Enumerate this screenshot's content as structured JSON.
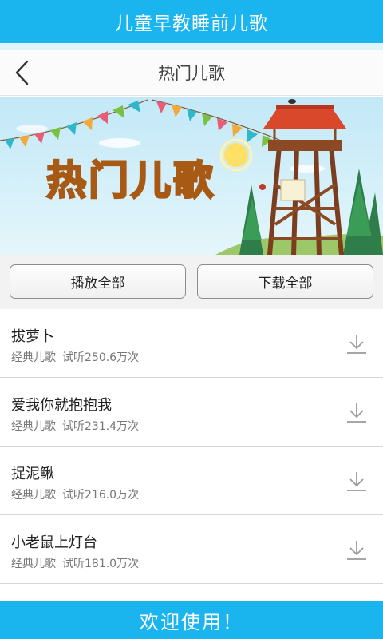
{
  "app_bar": {
    "title": "儿童早教睡前儿歌"
  },
  "nav": {
    "title": "热门儿歌"
  },
  "banner": {
    "title_art": "热门儿歌"
  },
  "actions": {
    "play_all": "播放全部",
    "download_all": "下载全部"
  },
  "songs": [
    {
      "title": "拔萝卜",
      "category": "经典儿歌",
      "plays": "试听250.6万次"
    },
    {
      "title": "爱我你就抱抱我",
      "category": "经典儿歌",
      "plays": "试听231.4万次"
    },
    {
      "title": "捉泥鳅",
      "category": "经典儿歌",
      "plays": "试听216.0万次"
    },
    {
      "title": "小老鼠上灯台",
      "category": "经典儿歌",
      "plays": "试听181.0万次"
    }
  ],
  "footer": {
    "text": "欢迎使用！"
  },
  "colors": {
    "accent": "#1ab4ee",
    "banner_sky": "#cfeef8"
  },
  "icons": {
    "back": "chevron-left-icon",
    "download": "download-icon"
  }
}
